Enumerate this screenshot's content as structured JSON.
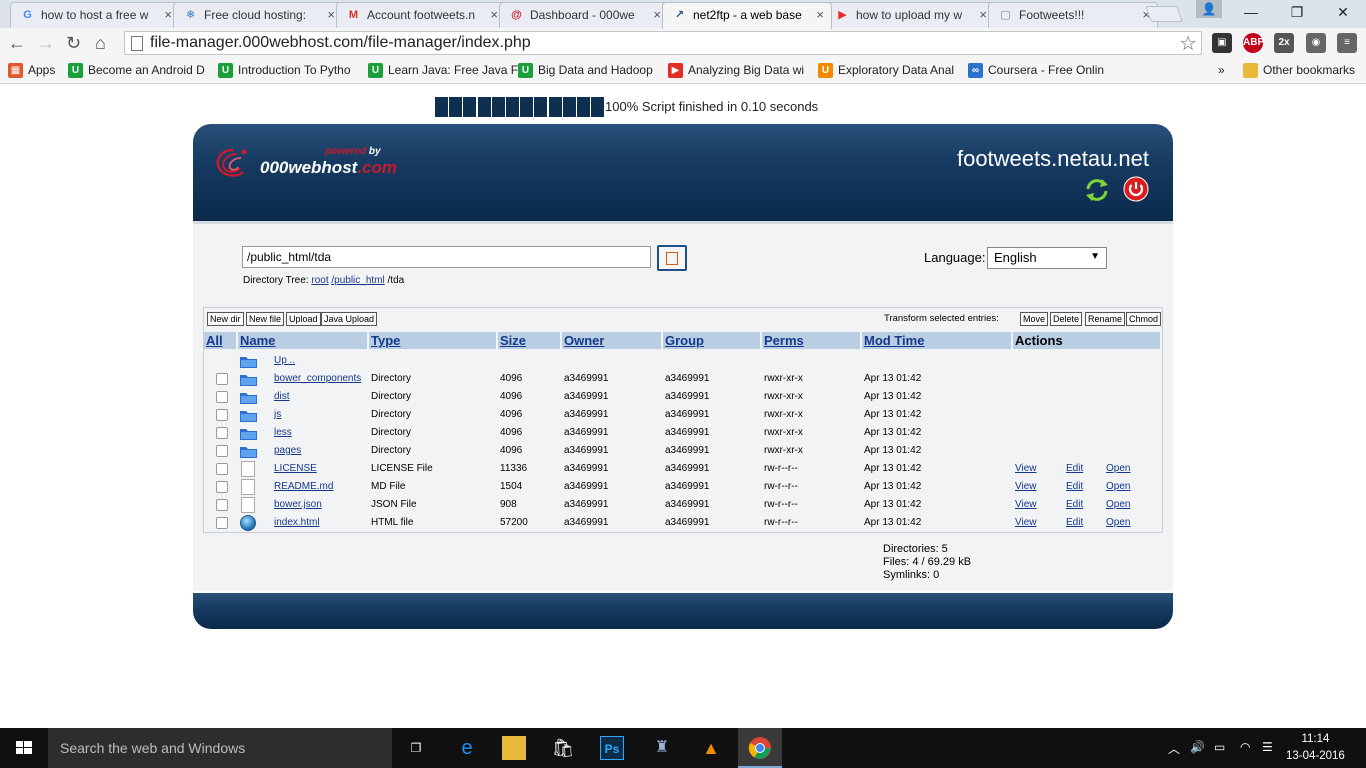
{
  "browser": {
    "tabs": [
      {
        "title": "how to host a free w",
        "icon": "google-icon",
        "color": "#4285f4",
        "glyph": "G"
      },
      {
        "title": "Free cloud hosting:",
        "icon": "snowflake-icon",
        "color": "#3b7cc4",
        "glyph": "❄"
      },
      {
        "title": "Account footweets.n",
        "icon": "gmail-icon",
        "color": "#d93025",
        "glyph": "M"
      },
      {
        "title": "Dashboard - 000we",
        "icon": "000webhost-icon",
        "color": "#c61b2d",
        "glyph": "@"
      },
      {
        "title": "net2ftp - a web base",
        "icon": "net2ftp-icon",
        "color": "#1d4f88",
        "glyph": "↗"
      },
      {
        "title": "how to upload my w",
        "icon": "youtube-icon",
        "color": "#e52d27",
        "glyph": "▶"
      },
      {
        "title": "Footweets!!!",
        "icon": "page-icon",
        "color": "#888888",
        "glyph": "▢"
      }
    ],
    "url": "file-manager.000webhost.com/file-manager/index.php",
    "bookmarks": [
      {
        "label": "Apps",
        "color": "#e0582b",
        "glyph": "▦"
      },
      {
        "label": "Become an Android D",
        "color": "#1aa03a",
        "glyph": "U"
      },
      {
        "label": "Introduction To Pytho",
        "color": "#1aa03a",
        "glyph": "U"
      },
      {
        "label": "Learn Java: Free Java F",
        "color": "#1aa03a",
        "glyph": "U"
      },
      {
        "label": "Big Data and Hadoop",
        "color": "#1aa03a",
        "glyph": "U"
      },
      {
        "label": "Analyzing Big Data wi",
        "color": "#e52d27",
        "glyph": "▶"
      },
      {
        "label": "Exploratory Data Anal",
        "color": "#f08a00",
        "glyph": "U"
      },
      {
        "label": "Coursera - Free Onlin",
        "color": "#2a73cc",
        "glyph": "∞"
      }
    ],
    "more_bookmarks": "»",
    "other_bookmarks": "Other bookmarks",
    "extensions": [
      {
        "name": "ext-grid-icon",
        "color": "#333333",
        "glyph": "▣"
      },
      {
        "name": "adblock-icon",
        "color": "#c4001a",
        "glyph": "ABP"
      },
      {
        "name": "ext-2x-icon",
        "color": "#555555",
        "glyph": "2x"
      },
      {
        "name": "ext-globe-icon",
        "color": "#666666",
        "glyph": "◉"
      },
      {
        "name": "menu-icon",
        "color": "#666666",
        "glyph": "≡"
      }
    ]
  },
  "progress": {
    "text": "100% Script finished in 0.10 seconds",
    "boxes": 12
  },
  "header": {
    "powered": "powered",
    "by": "by",
    "brand_main": "000webhost",
    "brand_suffix": ".com",
    "site": "footweets.netau.net"
  },
  "nav": {
    "directory": "/public_html/tda",
    "tree_label": "Directory Tree:",
    "tree_root": "root",
    "tree_public": "/public_html",
    "tree_current": "/tda",
    "language_label": "Language:",
    "language_value": "English"
  },
  "actions": {
    "new_dir": "New dir",
    "new_file": "New file",
    "upload": "Upload",
    "java_upload": "Java Upload",
    "transform_label": "Transform selected entries:",
    "move": "Move",
    "delete": "Delete",
    "rename": "Rename",
    "chmod": "Chmod"
  },
  "table": {
    "headers": {
      "all": "All",
      "name": "Name",
      "type": "Type",
      "size": "Size",
      "owner": "Owner",
      "group": "Group",
      "perms": "Perms",
      "mod_time": "Mod Time",
      "actions": "Actions"
    },
    "up": "Up ..",
    "rows": [
      {
        "name": "bower_components",
        "type": "Directory",
        "size": "4096",
        "owner": "a3469991",
        "group": "a3469991",
        "perms": "rwxr-xr-x",
        "mod": "Apr 13 01:42",
        "kind": "folder"
      },
      {
        "name": "dist",
        "type": "Directory",
        "size": "4096",
        "owner": "a3469991",
        "group": "a3469991",
        "perms": "rwxr-xr-x",
        "mod": "Apr 13 01:42",
        "kind": "folder"
      },
      {
        "name": "js",
        "type": "Directory",
        "size": "4096",
        "owner": "a3469991",
        "group": "a3469991",
        "perms": "rwxr-xr-x",
        "mod": "Apr 13 01:42",
        "kind": "folder"
      },
      {
        "name": "less",
        "type": "Directory",
        "size": "4096",
        "owner": "a3469991",
        "group": "a3469991",
        "perms": "rwxr-xr-x",
        "mod": "Apr 13 01:42",
        "kind": "folder"
      },
      {
        "name": "pages",
        "type": "Directory",
        "size": "4096",
        "owner": "a3469991",
        "group": "a3469991",
        "perms": "rwxr-xr-x",
        "mod": "Apr 13 01:42",
        "kind": "folder"
      },
      {
        "name": "LICENSE",
        "type": "LICENSE File",
        "size": "11336",
        "owner": "a3469991",
        "group": "a3469991",
        "perms": "rw-r--r--",
        "mod": "Apr 13 01:42",
        "kind": "file",
        "view": "View",
        "edit": "Edit",
        "open": "Open"
      },
      {
        "name": "README.md",
        "type": "MD File",
        "size": "1504",
        "owner": "a3469991",
        "group": "a3469991",
        "perms": "rw-r--r--",
        "mod": "Apr 13 01:42",
        "kind": "file",
        "view": "View",
        "edit": "Edit",
        "open": "Open"
      },
      {
        "name": "bower.json",
        "type": "JSON File",
        "size": "908",
        "owner": "a3469991",
        "group": "a3469991",
        "perms": "rw-r--r--",
        "mod": "Apr 13 01:42",
        "kind": "file",
        "view": "View",
        "edit": "Edit",
        "open": "Open"
      },
      {
        "name": "index.html",
        "type": "HTML file",
        "size": "57200",
        "owner": "a3469991",
        "group": "a3469991",
        "perms": "rw-r--r--",
        "mod": "Apr 13 01:42",
        "kind": "html",
        "view": "View",
        "edit": "Edit",
        "open": "Open"
      }
    ]
  },
  "stats": {
    "directories": "Directories: 5",
    "files": "Files: 4 / 69.29 kB",
    "symlinks": "Symlinks: 0"
  },
  "taskbar": {
    "search_placeholder": "Search the web and Windows",
    "time": "11:14",
    "date": "13-04-2016"
  },
  "colors": {
    "header_dark": "#0b2a4b",
    "header_light": "#2a5079",
    "table_header": "#b9cde3",
    "link": "#14398a",
    "brand_red": "#c61b2d"
  }
}
